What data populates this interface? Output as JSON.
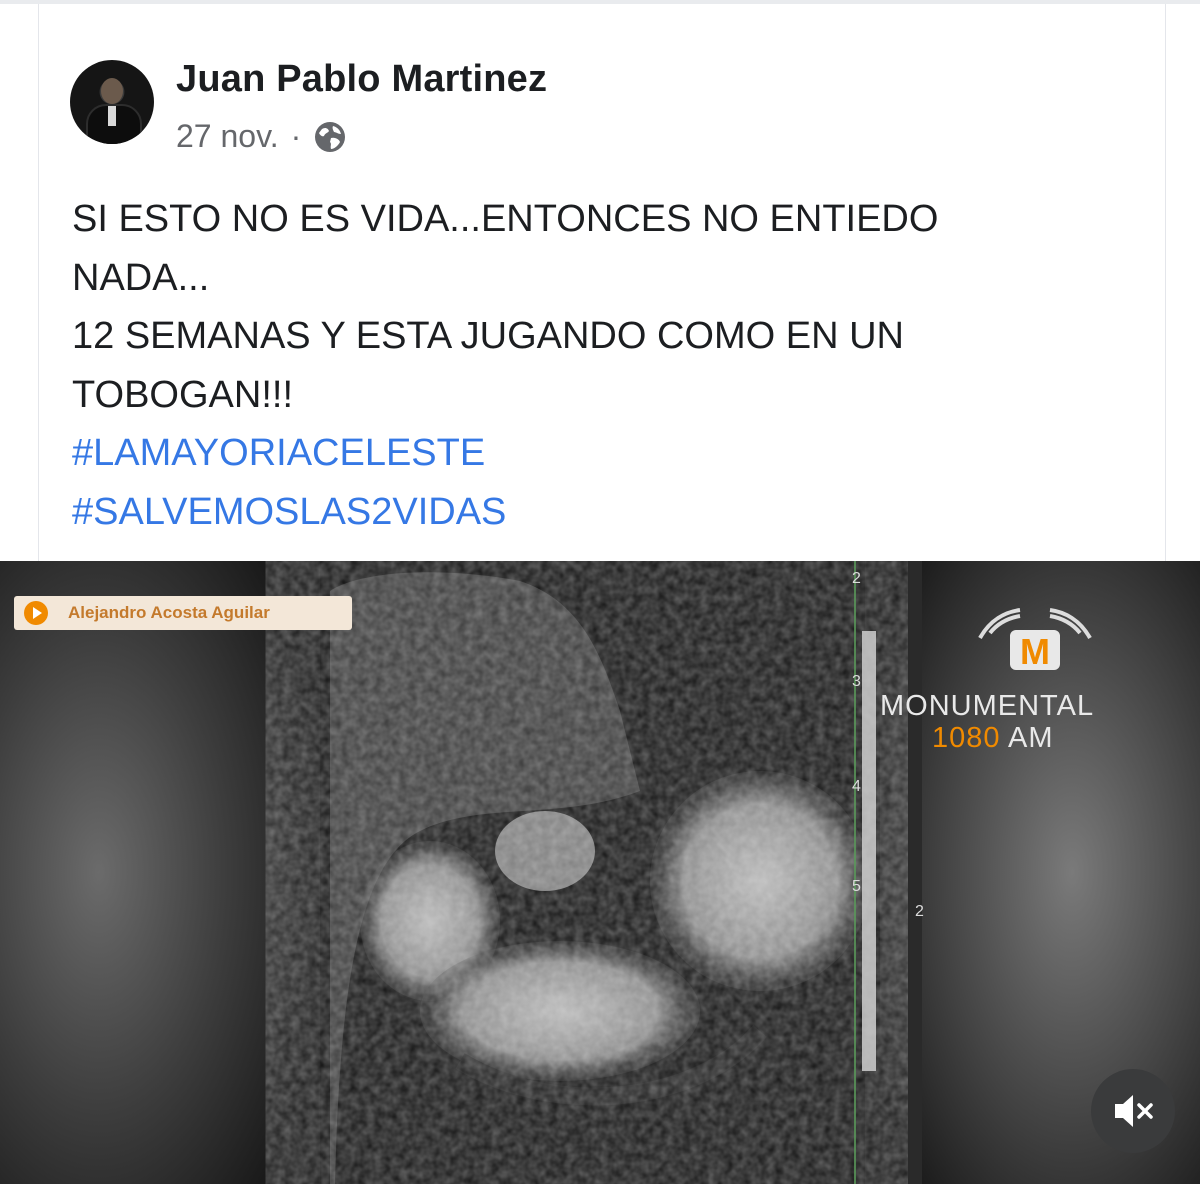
{
  "post": {
    "author": "Juan Pablo Martinez",
    "date": "27 nov.",
    "separator": "·",
    "privacy_icon": "globe-icon",
    "text_lines": [
      "SI ESTO NO ES VIDA...ENTONCES NO ENTIEDO",
      "NADA...",
      "12 SEMANAS Y ESTA JUGANDO COMO EN UN",
      "TOBOGAN!!!"
    ],
    "hashtags": [
      "#LAMAYORIACELESTE",
      "#SALVEMOSLAS2VIDAS"
    ]
  },
  "video": {
    "overlay_tag": "Alejandro Acosta Aguilar",
    "logo_letter": "M",
    "logo_title": "MONUMENTAL",
    "logo_freq": "1080",
    "logo_band": "AM",
    "scale_labels": [
      "2",
      "3",
      "4",
      "5",
      "2"
    ],
    "mute_icon": "speaker-muted-icon",
    "accent_color": "#f08a00"
  },
  "colors": {
    "author": "#1c1e21",
    "meta": "#65676b",
    "hashtag": "#3578e5"
  }
}
